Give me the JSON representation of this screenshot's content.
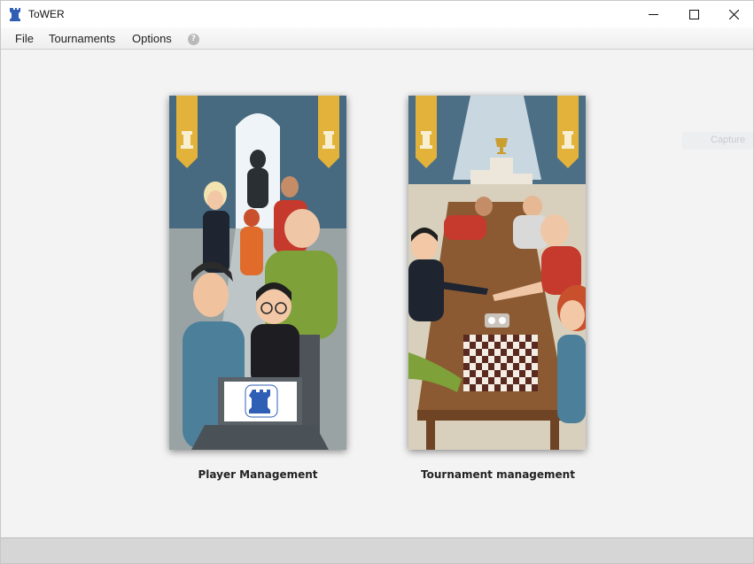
{
  "window": {
    "title": "ToWER",
    "controls": {
      "minimize": "minimize-icon",
      "maximize": "maximize-icon",
      "close": "close-icon"
    }
  },
  "menu": {
    "items": [
      {
        "label": "File"
      },
      {
        "label": "Tournaments"
      },
      {
        "label": "Options"
      }
    ],
    "help_icon": "?"
  },
  "main": {
    "cards": [
      {
        "caption": "Player Management",
        "image": "player-management-illustration"
      },
      {
        "caption": "Tournament management",
        "image": "tournament-management-illustration"
      }
    ],
    "ghost_button": "Capture"
  },
  "colors": {
    "accent": "#2f5fb5",
    "banner_gold": "#e2b23a",
    "table_wood": "#8b5a32",
    "wall_blue": "#4d6f86"
  }
}
